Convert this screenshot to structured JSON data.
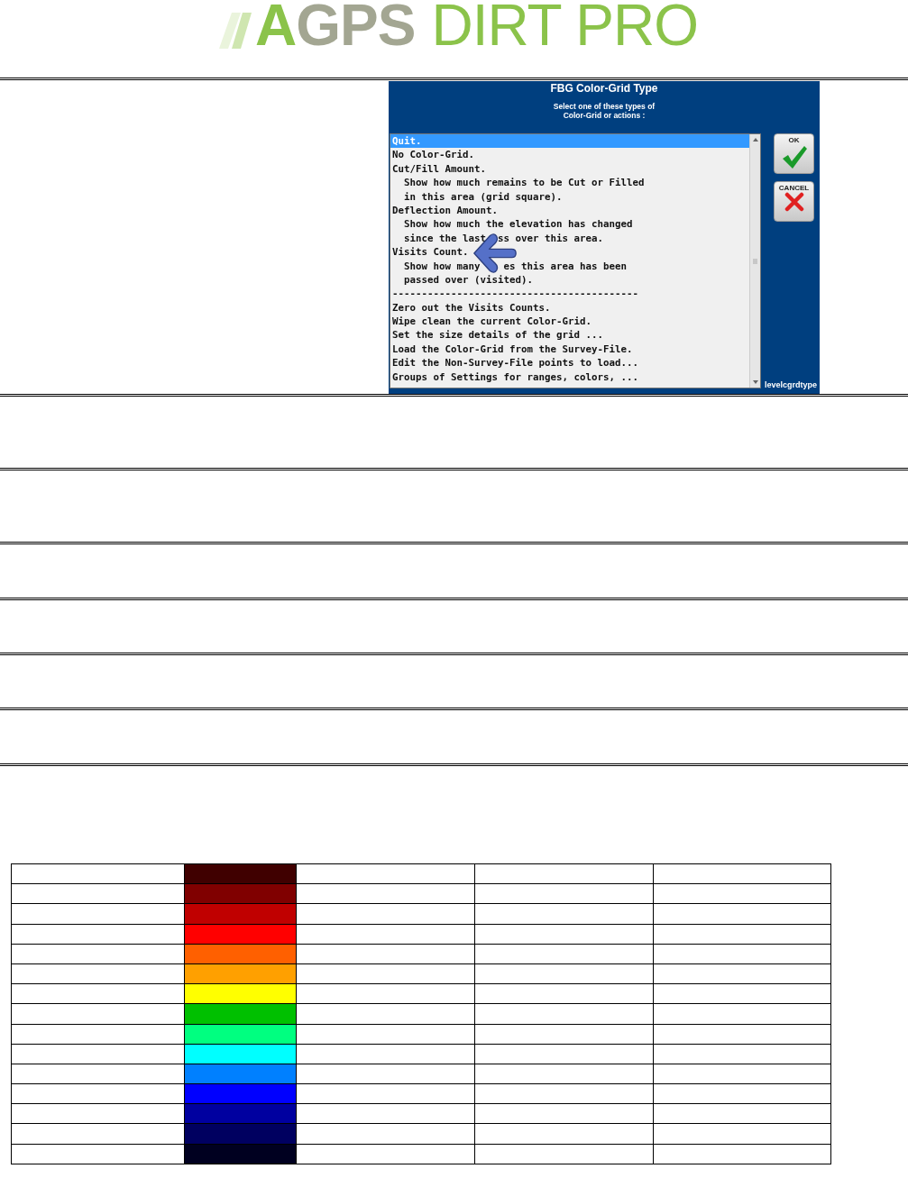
{
  "logo": {
    "lead": "A",
    "mark": "GPS",
    "product": "DIRT PRO"
  },
  "dialog": {
    "title": "FBG Color-Grid Type",
    "subtitle": [
      "Select one of these types of",
      "Color-Grid or actions :"
    ],
    "items": [
      {
        "kind": "option",
        "text": "Quit.",
        "selected": true
      },
      {
        "kind": "option",
        "text": "No Color-Grid.",
        "selected": false
      },
      {
        "kind": "option",
        "text": "Cut/Fill Amount.",
        "selected": false
      },
      {
        "kind": "note",
        "text": "Show how much remains to be Cut or Filled",
        "selected": false
      },
      {
        "kind": "note",
        "text": "in this area (grid square).",
        "selected": false
      },
      {
        "kind": "option",
        "text": "Deflection Amount.",
        "selected": false
      },
      {
        "kind": "note",
        "text": "Show how much the elevation has changed",
        "selected": false
      },
      {
        "kind": "note",
        "text": "since the last  ss over this area.",
        "selected": false
      },
      {
        "kind": "option",
        "text": "Visits Count.",
        "selected": false
      },
      {
        "kind": "note",
        "text": "Show how many    es this area has been",
        "selected": false
      },
      {
        "kind": "note",
        "text": "passed over (visited).",
        "selected": false
      },
      {
        "kind": "rule",
        "text": "------------------------------------------",
        "selected": false
      },
      {
        "kind": "option",
        "text": "Zero out the Visits Counts.",
        "selected": false
      },
      {
        "kind": "option",
        "text": "Wipe clean the current Color-Grid.",
        "selected": false
      },
      {
        "kind": "option",
        "text": "Set the size details of the grid ...",
        "selected": false
      },
      {
        "kind": "option",
        "text": "Load the Color-Grid from the Survey-File.",
        "selected": false
      },
      {
        "kind": "option",
        "text": "Edit the Non-Survey-File points to load...",
        "selected": false
      },
      {
        "kind": "option",
        "text": "Groups of Settings for ranges, colors, ...",
        "selected": false
      }
    ],
    "buttons": [
      {
        "kind": "ok",
        "label": "OK"
      },
      {
        "kind": "cancel",
        "label": "CANCEL"
      }
    ],
    "name": "levelcgrdtype"
  },
  "color_table": {
    "rows": [
      {
        "color": "#400000"
      },
      {
        "color": "#800000"
      },
      {
        "color": "#c00000"
      },
      {
        "color": "#ff0000"
      },
      {
        "color": "#ff6000"
      },
      {
        "color": "#ffa000"
      },
      {
        "color": "#ffff00"
      },
      {
        "color": "#00c000"
      },
      {
        "color": "#00ff80"
      },
      {
        "color": "#00ffff"
      },
      {
        "color": "#0080ff"
      },
      {
        "color": "#0000ff"
      },
      {
        "color": "#0000a0"
      },
      {
        "color": "#000060"
      },
      {
        "color": "#000020"
      }
    ]
  }
}
